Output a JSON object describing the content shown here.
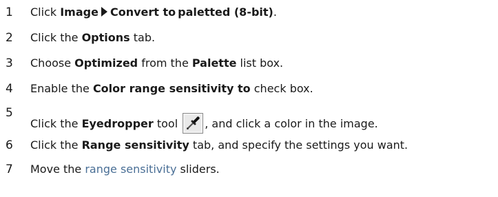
{
  "steps": [
    {
      "number": "1",
      "parts": [
        "Click ",
        "Image",
        "Convert to",
        "paletted (8-bit)",
        "."
      ]
    },
    {
      "number": "2",
      "parts": [
        "Click the ",
        "Options",
        " tab."
      ]
    },
    {
      "number": "3",
      "parts": [
        "Choose ",
        "Optimized",
        " from the ",
        "Palette",
        " list box."
      ]
    },
    {
      "number": "4",
      "parts": [
        "Enable the ",
        "Color range sensitivity to",
        " check box."
      ]
    },
    {
      "number": "5",
      "parts": [
        "Click the ",
        "Eyedropper",
        " tool ",
        ", and click a color in the image."
      ],
      "icon": "eyedropper-icon"
    },
    {
      "number": "6",
      "parts": [
        "Click the ",
        "Range sensitivity",
        " tab, and specify the settings you want."
      ]
    },
    {
      "number": "7",
      "parts": [
        "Move the ",
        "range sensitivity",
        " sliders."
      ]
    }
  ],
  "colors": {
    "text": "#1a1a1a",
    "link": "#4a6f96"
  }
}
